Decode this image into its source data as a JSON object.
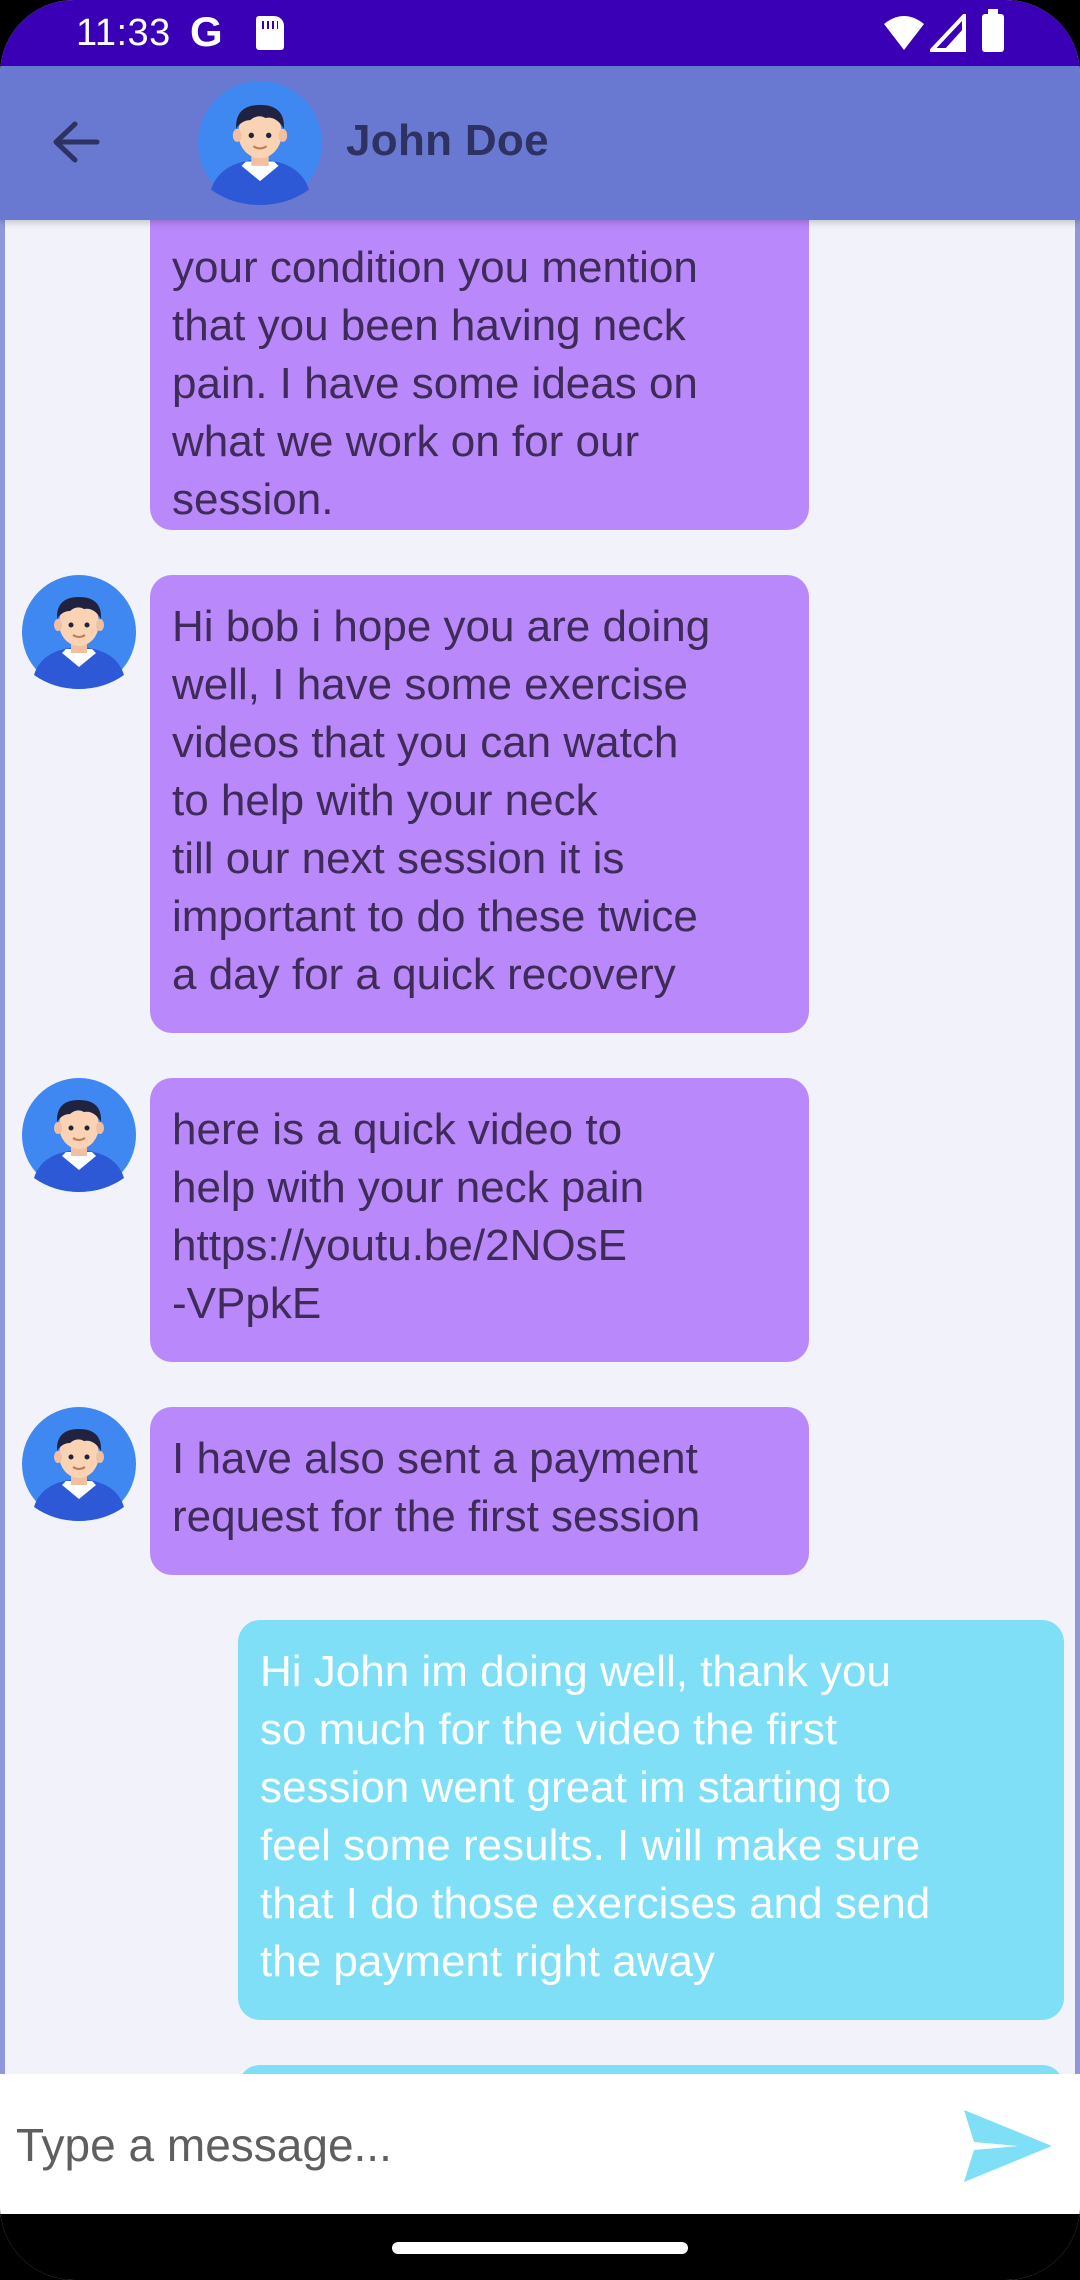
{
  "status_bar": {
    "time": "11:33",
    "g_label": "G"
  },
  "header": {
    "contact_name": "John Doe"
  },
  "messages": [
    {
      "direction": "in",
      "text": "your condition you mention\nthat you been having neck\npain. I have some ideas on\nwhat we work on for our\nsession."
    },
    {
      "direction": "in",
      "text": "Hi bob i hope you are doing\nwell, I have some exercise\nvideos that you can watch\nto help with your neck\ntill our next session it is\nimportant to do these twice\na day for a quick recovery"
    },
    {
      "direction": "in",
      "text": "here is a quick video to\nhelp with your neck pain\nhttps://youtu.be/2NOsE\n-VPpkE"
    },
    {
      "direction": "in",
      "text": "I have also sent a payment\nrequest for the first session"
    },
    {
      "direction": "out",
      "text": "Hi John im doing well, thank you\nso much for the video the first\nsession went great im starting to\nfeel some results. I will make sure\nthat I do those exercises and send\nthe payment right away"
    },
    {
      "direction": "out",
      "text": ""
    }
  ],
  "input": {
    "placeholder": "Type a message..."
  },
  "colors": {
    "status_bar": "#3a00b5",
    "app_bar": "#6979d2",
    "incoming_bubble": "#b988fb",
    "outgoing_bubble": "#7fdff7",
    "send_icon": "#7fdff7"
  },
  "icons": {
    "back": "arrow-left-icon",
    "send": "send-icon",
    "avatar": "avatar-icon"
  }
}
